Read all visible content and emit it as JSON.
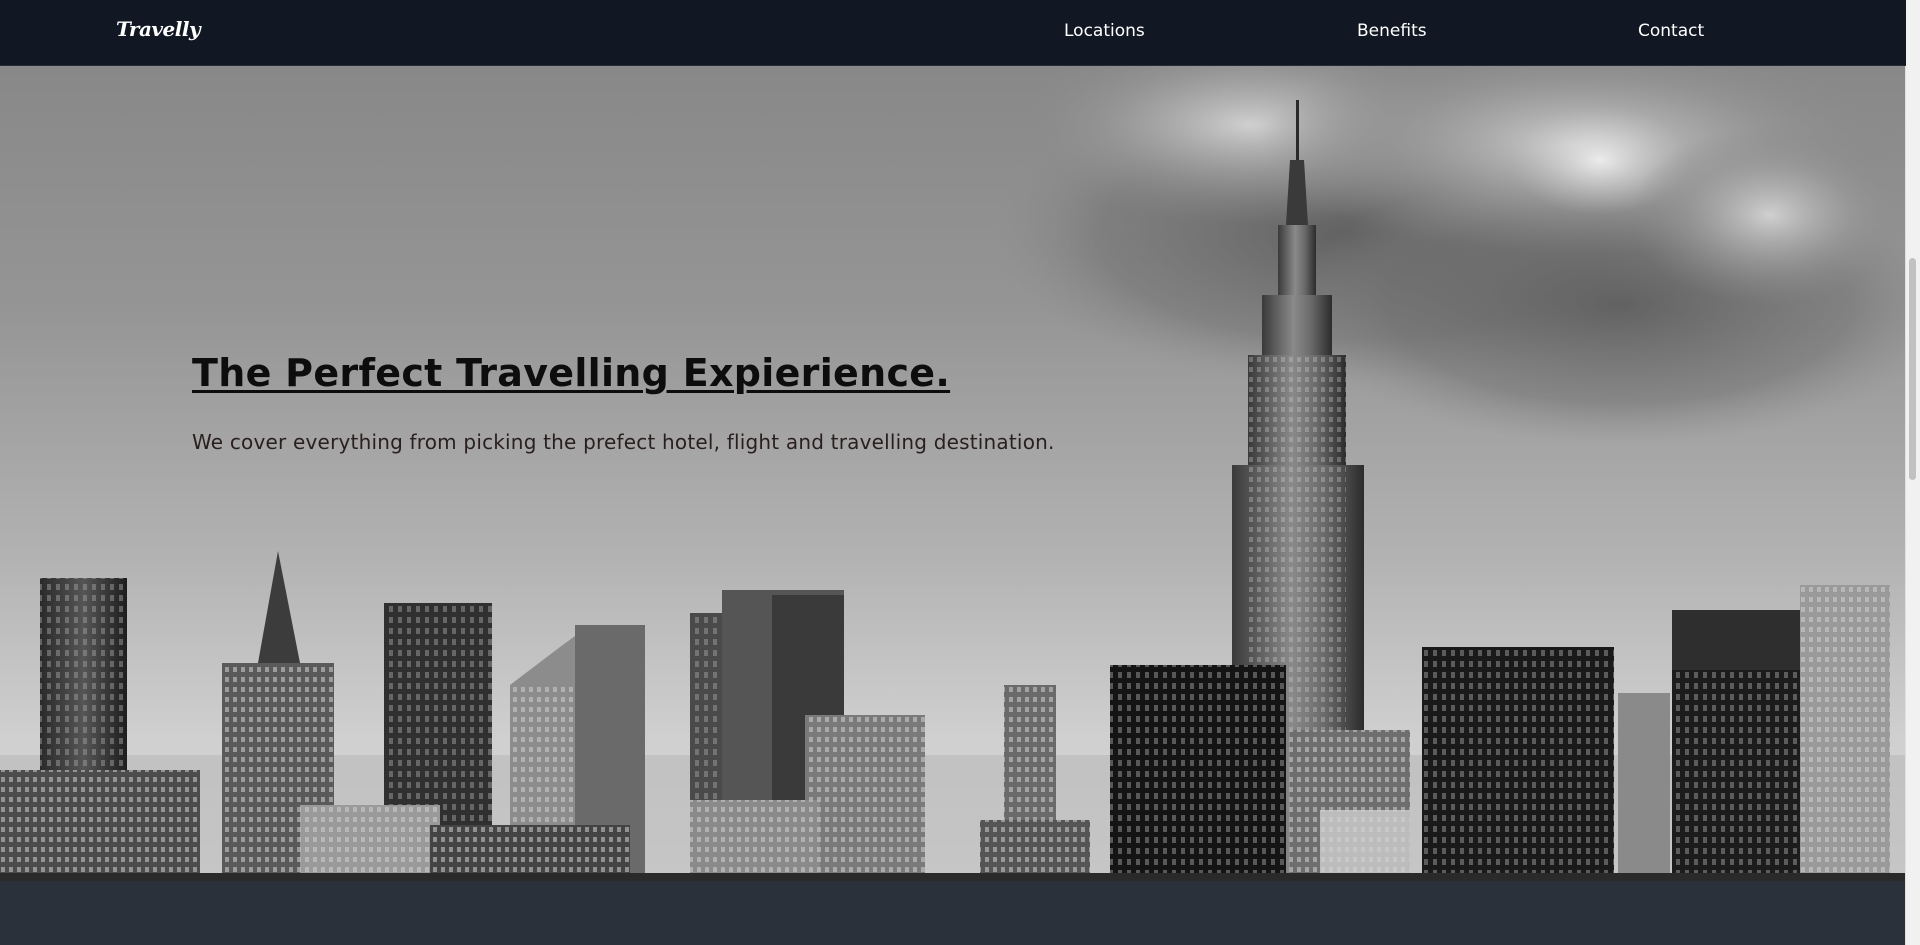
{
  "navbar": {
    "logo": "Travelly",
    "links": [
      {
        "label": "Locations"
      },
      {
        "label": "Benefits"
      },
      {
        "label": "Contact"
      }
    ]
  },
  "hero": {
    "title": "The Perfect Travelling Expierience.",
    "subtitle": "We cover everything from picking the prefect hotel, flight and travelling destination."
  },
  "colors": {
    "navbar_bg": "#111823",
    "footer_bg": "#2b313b",
    "text_light": "#ffffff",
    "hero_text": "#0d0d0d"
  }
}
